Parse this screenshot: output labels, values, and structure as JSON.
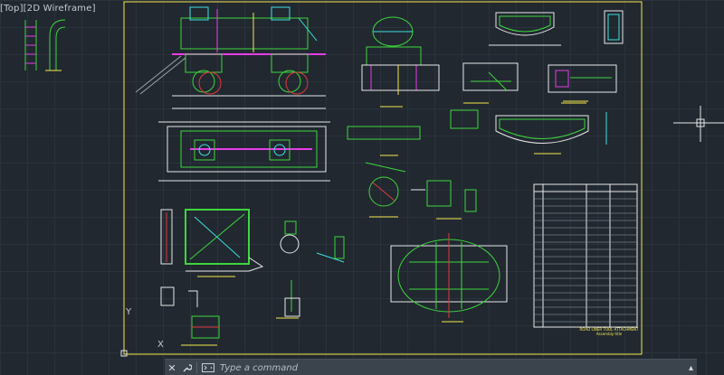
{
  "viewport": {
    "label": "[Top][2D Wireframe]",
    "background": "#212830",
    "grid_color": "#2a323c",
    "ucs_y": "Y",
    "ucs_x": "X"
  },
  "drawing": {
    "border_color": "#f5e84a",
    "line_colors": {
      "green": "#3dd63d",
      "magenta": "#e83ce8",
      "cyan": "#3de0e0",
      "yellow": "#f5e84a",
      "white": "#e8e8e8",
      "red": "#e03a3a",
      "gray": "#9aa3ad"
    },
    "title_block": {
      "title": "ROAD LINER TOOL ATTACHMENT",
      "subtitle": "Assembly title"
    }
  },
  "command_line": {
    "close_icon": "close-icon",
    "settings_icon": "wrench-icon",
    "prompt_icon": "command-prompt-icon",
    "placeholder": "Type a command",
    "value": ""
  }
}
